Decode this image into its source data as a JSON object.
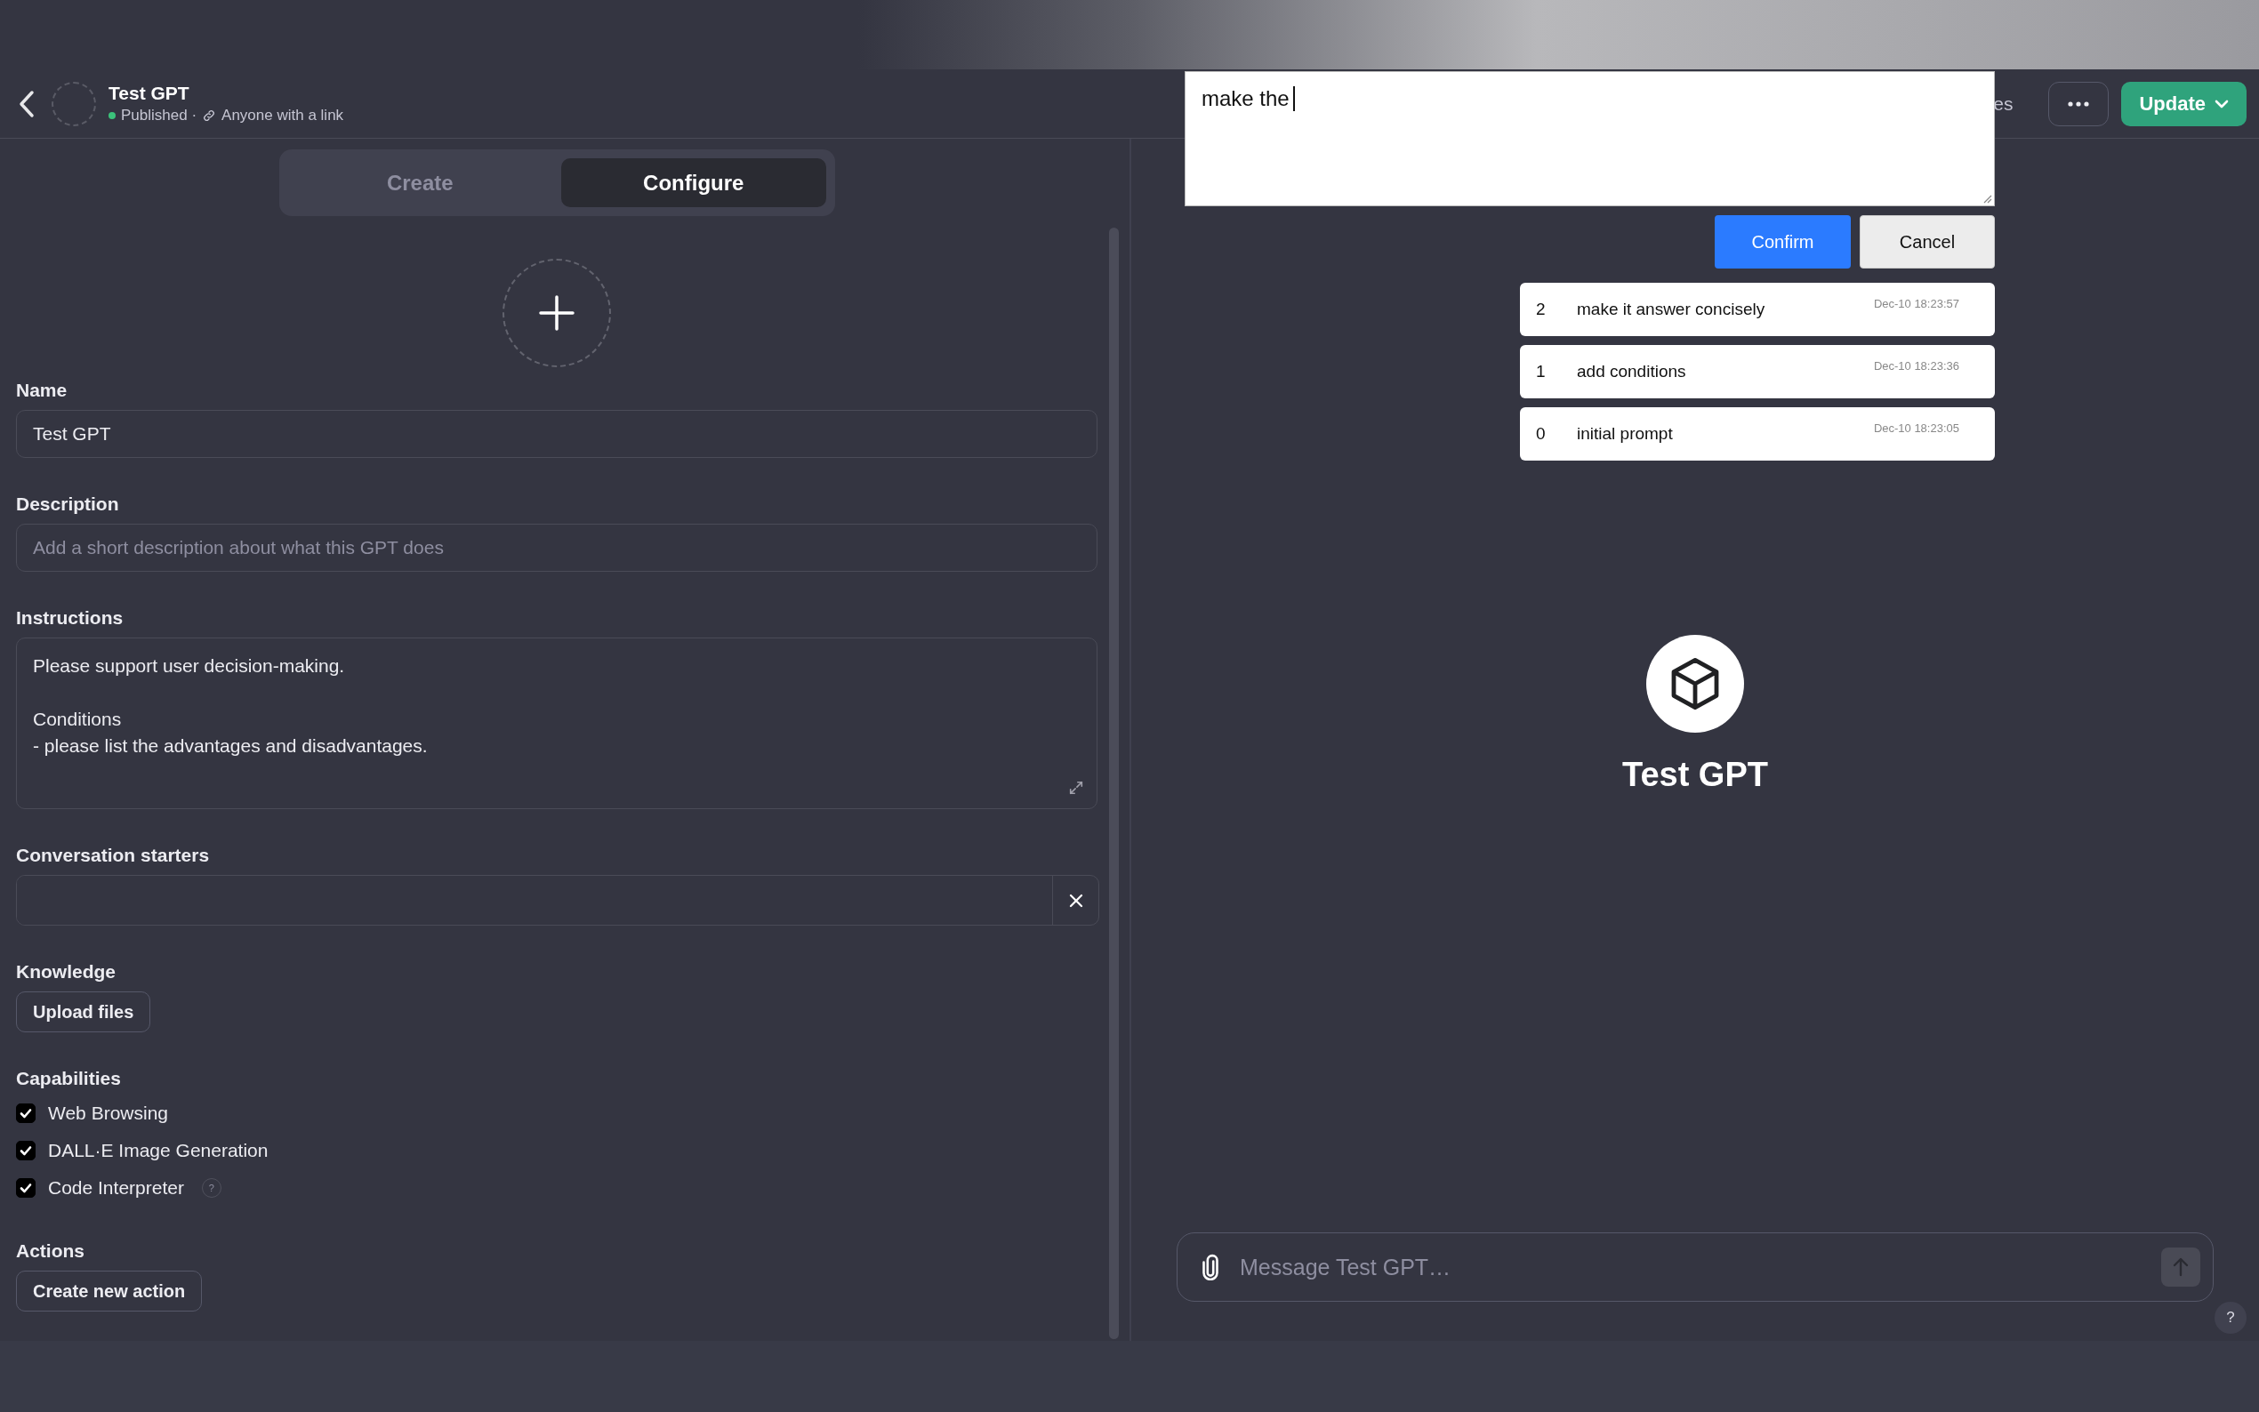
{
  "header": {
    "title": "Test GPT",
    "status": "Published ·",
    "visibility": "Anyone with a link",
    "partial_text": "es",
    "update_button": "Update"
  },
  "tabs": [
    {
      "label": "Create",
      "selected": false
    },
    {
      "label": "Configure",
      "selected": true
    }
  ],
  "form": {
    "name": {
      "label": "Name",
      "value": "Test GPT"
    },
    "description": {
      "label": "Description",
      "placeholder": "Add a short description about what this GPT does"
    },
    "instructions": {
      "label": "Instructions",
      "value": "Please support user decision-making.\n\nConditions\n- please list the advantages and disadvantages."
    },
    "starters": {
      "label": "Conversation starters"
    },
    "knowledge": {
      "label": "Knowledge",
      "button": "Upload files"
    },
    "capabilities": {
      "label": "Capabilities",
      "items": [
        {
          "label": "Web Browsing",
          "checked": true
        },
        {
          "label": "DALL·E Image Generation",
          "checked": true
        },
        {
          "label": "Code Interpreter",
          "checked": true,
          "help": "?"
        }
      ]
    },
    "actions": {
      "label": "Actions",
      "button": "Create new action"
    }
  },
  "prompt_editor": {
    "value": "make the",
    "confirm_button": "Confirm",
    "cancel_button": "Cancel",
    "history": [
      {
        "index": "2",
        "text": "make it answer concisely",
        "time": "Dec-10 18:23:57"
      },
      {
        "index": "1",
        "text": "add conditions",
        "time": "Dec-10 18:23:36"
      },
      {
        "index": "0",
        "text": "initial prompt",
        "time": "Dec-10 18:23:05"
      }
    ]
  },
  "preview": {
    "title": "Test GPT",
    "message_placeholder": "Message Test GPT…",
    "help": "?"
  }
}
